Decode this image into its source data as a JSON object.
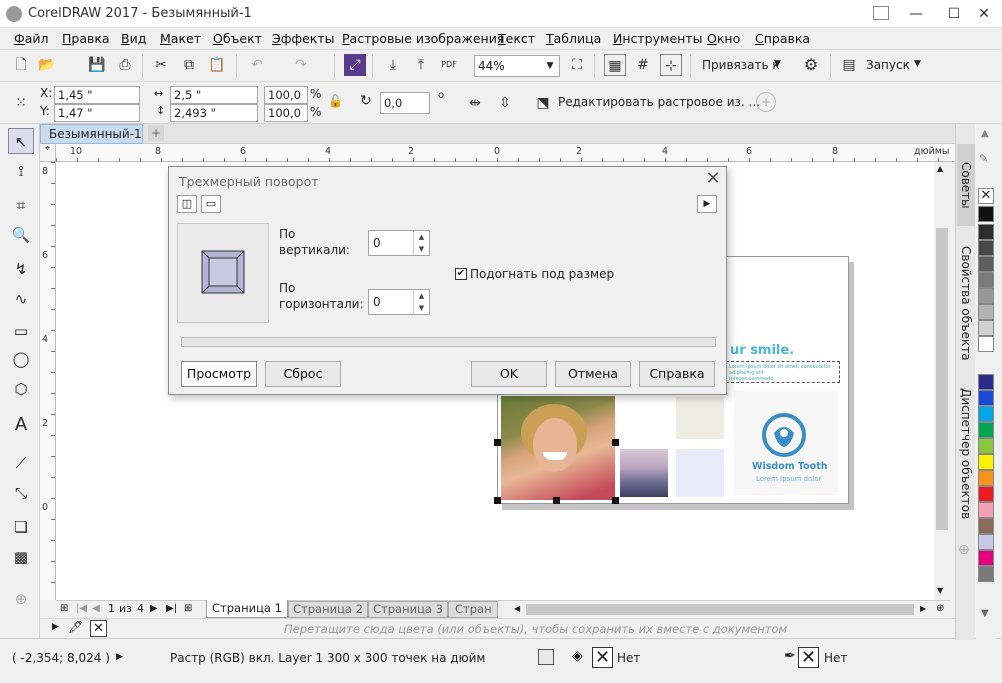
{
  "window": {
    "title": "CorelDRAW 2017 - Безымянный-1",
    "min": "—",
    "max": "☐",
    "close": "✕"
  },
  "menu": [
    "Файл",
    "Правка",
    "Вид",
    "Макет",
    "Объект",
    "Эффекты",
    "Растровые изображения",
    "Текст",
    "Таблица",
    "Инструменты",
    "Окно",
    "Справка"
  ],
  "toolbar": {
    "zoom": "44%",
    "snap_label": "Привязать к",
    "launch_label": "Запуск",
    "pdf_label": "PDF"
  },
  "propbar": {
    "x_label": "X:",
    "x_value": "1,45 \"",
    "y_label": "Y:",
    "y_value": "1,47 \"",
    "w_value": "2,5 \"",
    "h_value": "2,493 \"",
    "scale_w": "100,0",
    "scale_h": "100,0",
    "percent": "%",
    "angle": "0,0",
    "degree": "o",
    "edit_bitmap": "Редактировать растровое из. ..."
  },
  "doc_tab": {
    "name": "Безымянный-1",
    "add": "+"
  },
  "ruler": {
    "unit": "дюймы",
    "h_ticks": [
      "10",
      "8",
      "6",
      "4",
      "2",
      "0",
      "2",
      "4",
      "6",
      "8"
    ],
    "v_ticks": [
      "8",
      "6",
      "4",
      "2",
      "0"
    ]
  },
  "dialog": {
    "title": "Трехмерный поворот",
    "vertical_label_1": "По",
    "vertical_label_2": "вертикали:",
    "vertical_value": "0",
    "horizontal_label_1": "По",
    "horizontal_label_2": "горизонтали:",
    "horizontal_value": "0",
    "fit_label": "Подогнать под размер",
    "fit_checked": true,
    "preview_button": "Просмотр",
    "reset_button": "Сброс",
    "ok_button": "OK",
    "cancel_button": "Отмена",
    "help_button": "Справка"
  },
  "artwork": {
    "headline": "ur smile.",
    "tiny_text_1": "Lorem ipsum dolor sit amet, consectetur adipiscing elit",
    "tiny_text_2": "Integer commodo.",
    "brand_name": "Wisdom Tooth",
    "brand_sub": "Lorem ipsum dolor",
    "brand_color": "#3a8ec8"
  },
  "pages": {
    "current": "1",
    "of": "из",
    "total": "4",
    "tabs": [
      "Страница 1",
      "Страница 2",
      "Страница 3",
      "Стран"
    ]
  },
  "palette_hint": "Перетащите сюда цвета (или объекты), чтобы сохранить их вместе с документом",
  "status": {
    "coords": "( -2,354; 8,024 )",
    "info": "Растр (RGB) вкл. Layer 1 300 x 300 точек на дюйм",
    "fill": "Нет",
    "outline": "Нет"
  },
  "dockers": [
    "Советы",
    "Свойства объекта",
    "Диспетчер объектов"
  ],
  "palette_colors": [
    "#ffffff",
    "#111111",
    "#2b2b2b",
    "#474747",
    "#5f5f5f",
    "#7b7b7b",
    "#979797",
    "#b3b3b3",
    "#d1d1d1",
    "#ffffff",
    "#2b2b8c",
    "#1a48d8",
    "#00a6e8",
    "#00a651",
    "#8cc63f",
    "#fff200",
    "#f7941d",
    "#ed1c24",
    "#f3a0b4",
    "#8a6a5a",
    "#c8c8e8",
    "#e5007e",
    "#7a7a7a"
  ]
}
